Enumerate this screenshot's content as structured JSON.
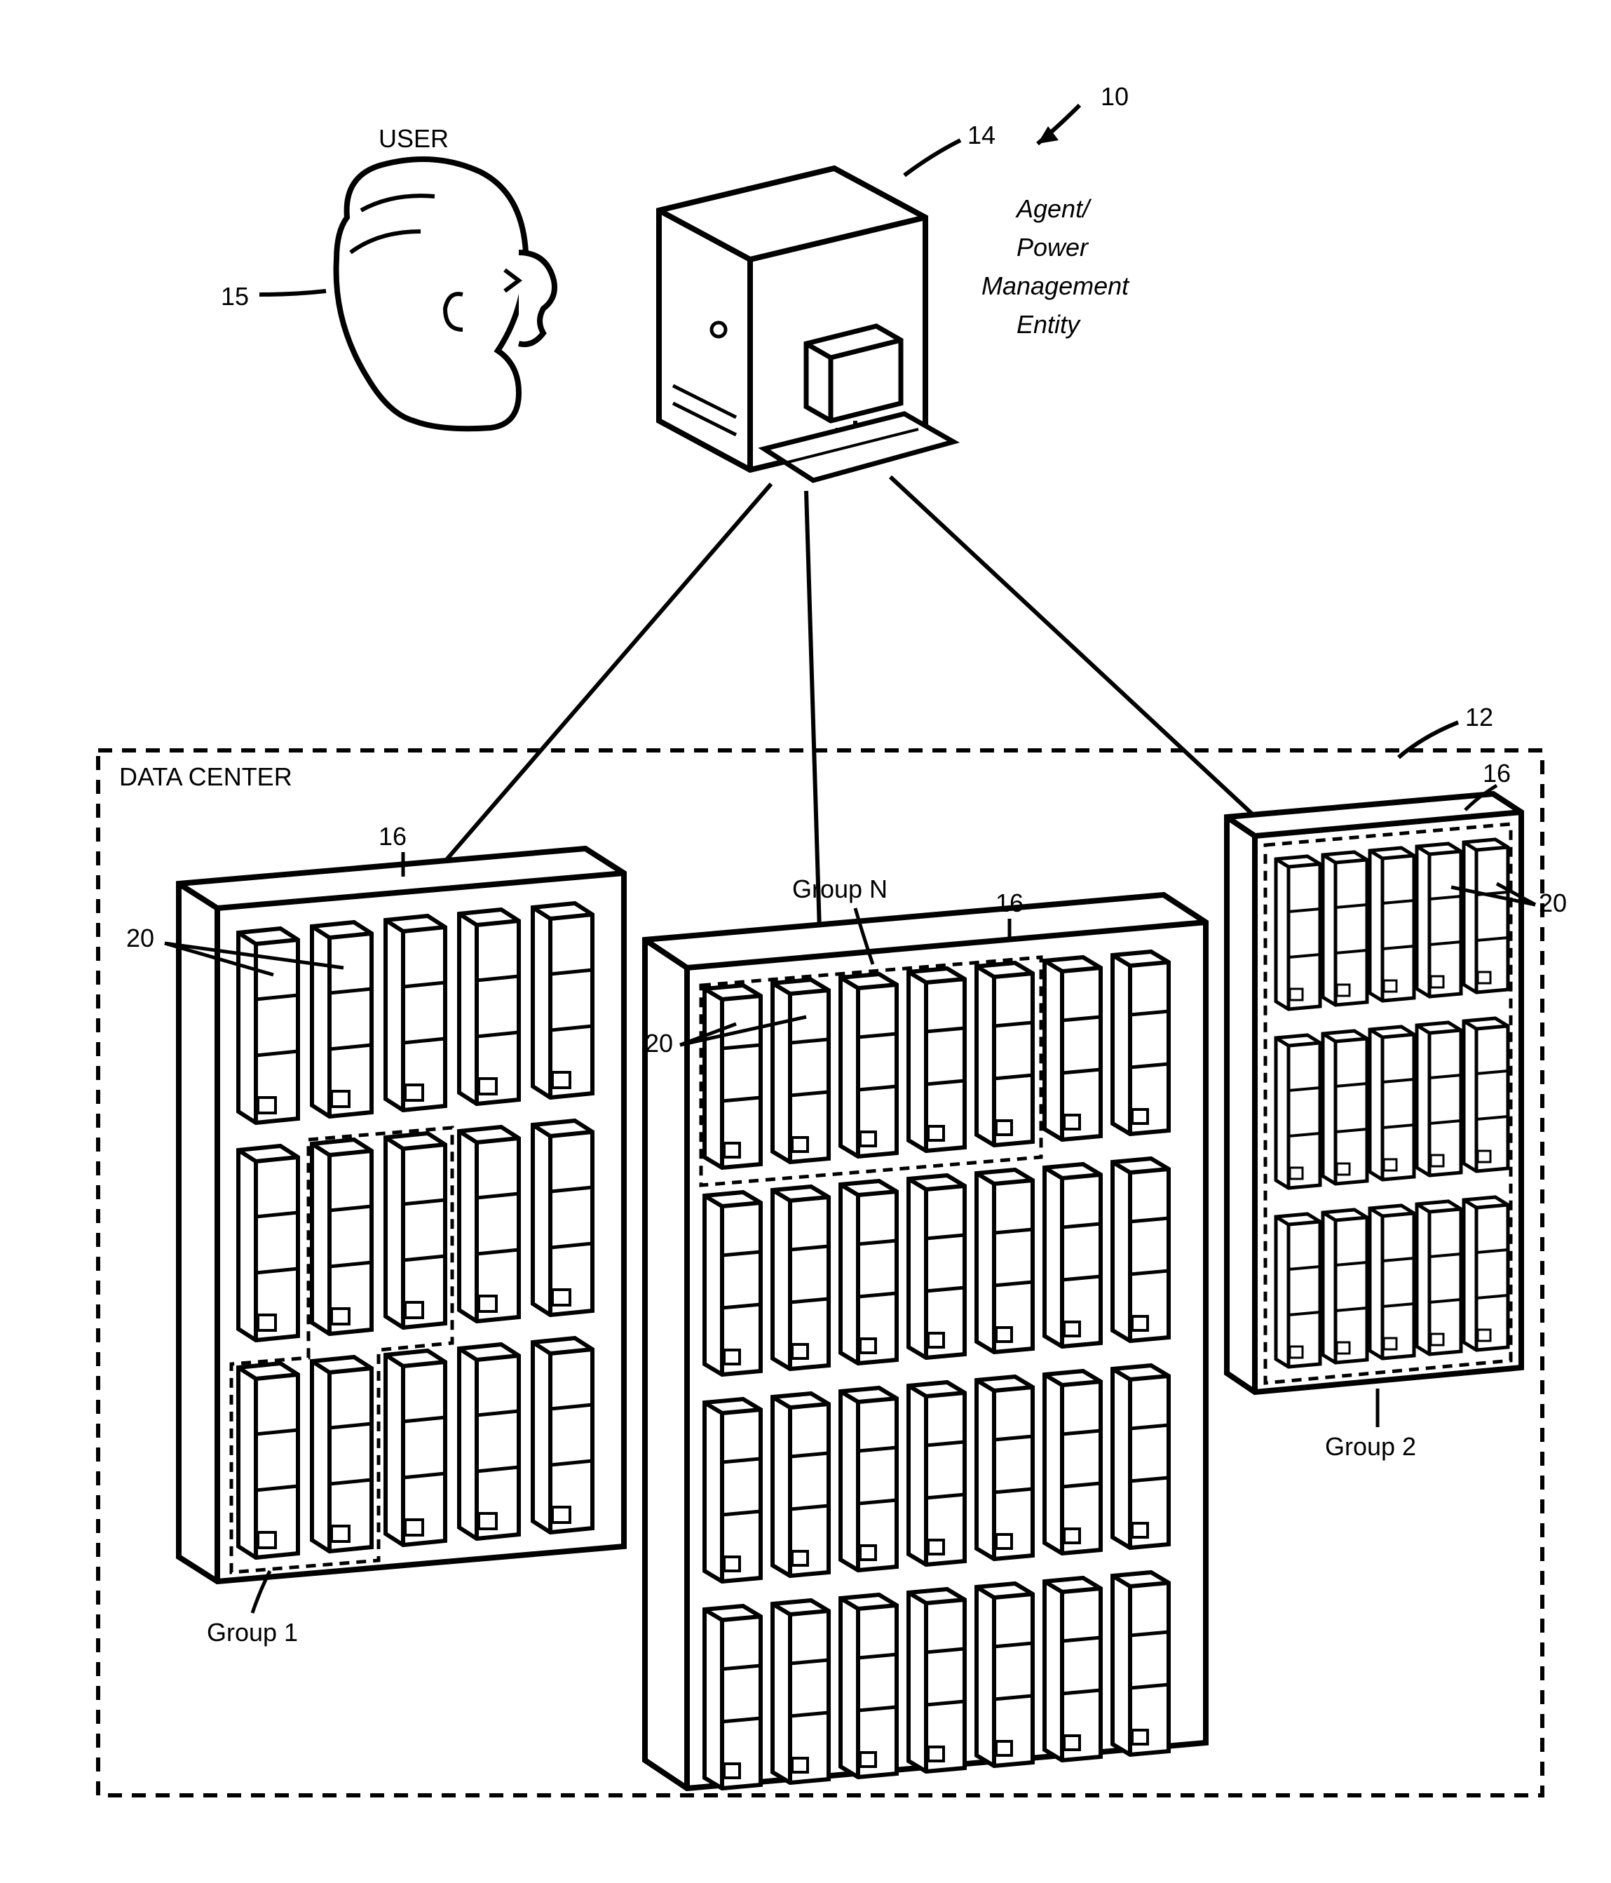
{
  "labels": {
    "user": "USER",
    "agent_line1": "Agent/",
    "agent_line2": "Power",
    "agent_line3": "Management",
    "agent_line4": "Entity",
    "datacenter": "DATA CENTER",
    "group1": "Group 1",
    "group2": "Group 2",
    "groupN": "Group N",
    "ref10": "10",
    "ref12": "12",
    "ref14": "14",
    "ref15": "15",
    "ref16": "16",
    "ref20": "20"
  }
}
